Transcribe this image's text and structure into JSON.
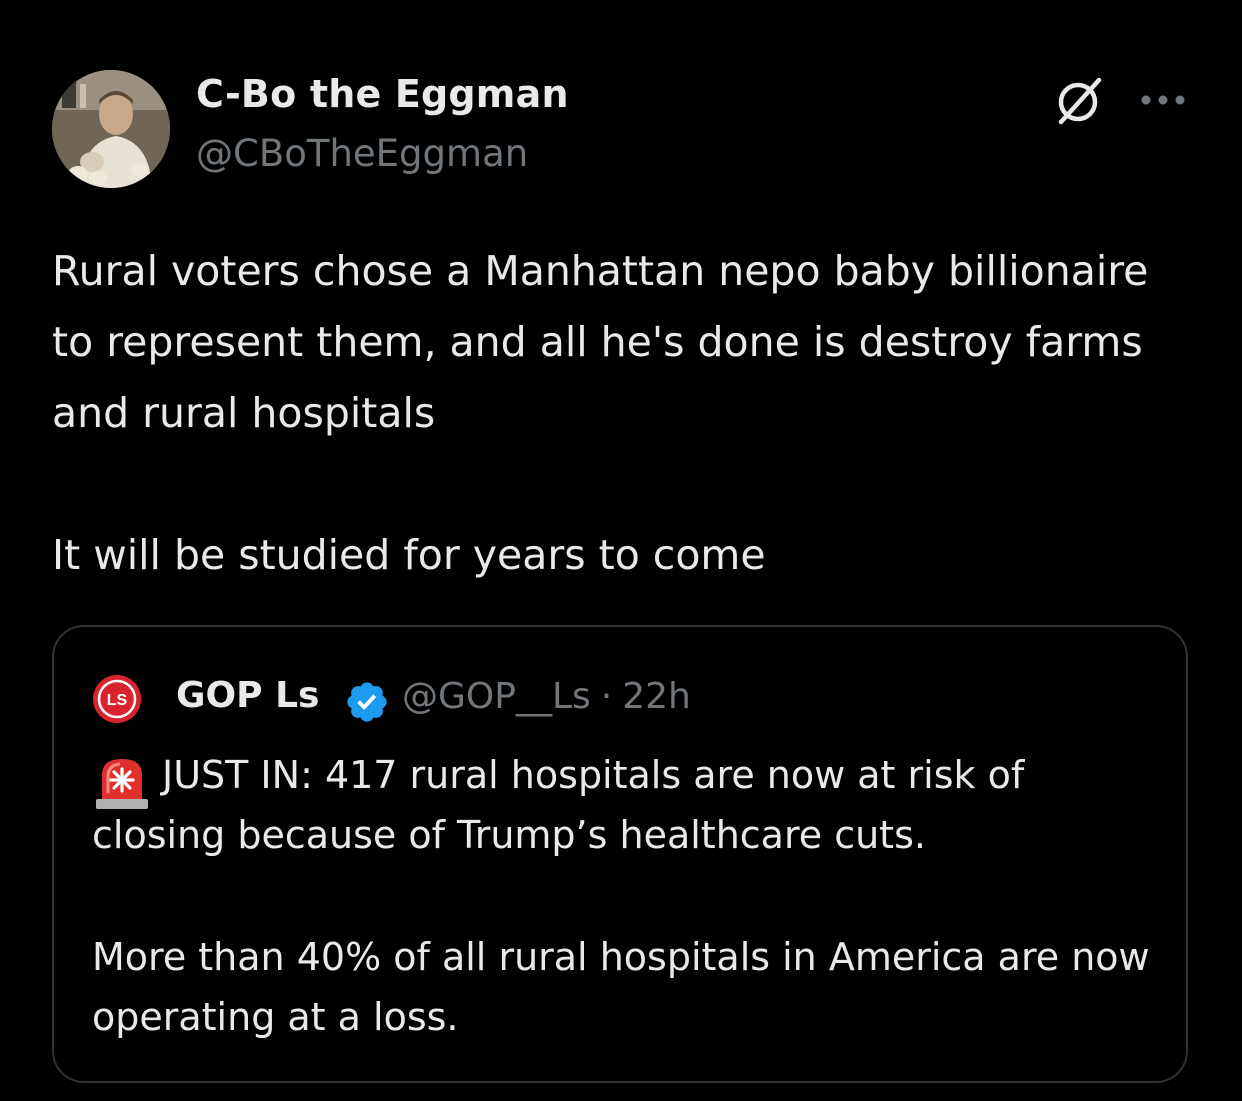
{
  "tweet": {
    "author": {
      "display_name": "C-Bo the Eggman",
      "handle": "@CBoTheEggman",
      "avatar_icon": "profile-photo"
    },
    "icons": {
      "grok": "grok-icon",
      "more": "more-options-icon"
    },
    "body": {
      "paragraph_1": "Rural voters chose a Manhattan nepo baby billionaire to represent them, and all he's done is destroy farms and rural hospitals",
      "paragraph_2": "It will be studied for years to come"
    }
  },
  "quote": {
    "author": {
      "display_name": "GOP Ls",
      "handle": "@GOP__Ls",
      "separator": "·",
      "time": "22h",
      "avatar_icon": "gop-ls-logo",
      "verified_icon": "verified-badge-icon",
      "verified_color": "#1d9bf0"
    },
    "body": {
      "alert_icon": "rotating-light-emoji",
      "paragraph_1": "JUST IN: 417 rural hospitals are now at risk of closing because of Trump’s healthcare cuts.",
      "paragraph_2": "More than 40% of all rural hospitals in America are now operating at a loss."
    }
  },
  "colors": {
    "background": "#000000",
    "text_primary": "#e7e9ea",
    "text_secondary": "#71767b",
    "border": "#2f3336",
    "accent": "#1d9bf0",
    "logo_red": "#d9232e"
  }
}
